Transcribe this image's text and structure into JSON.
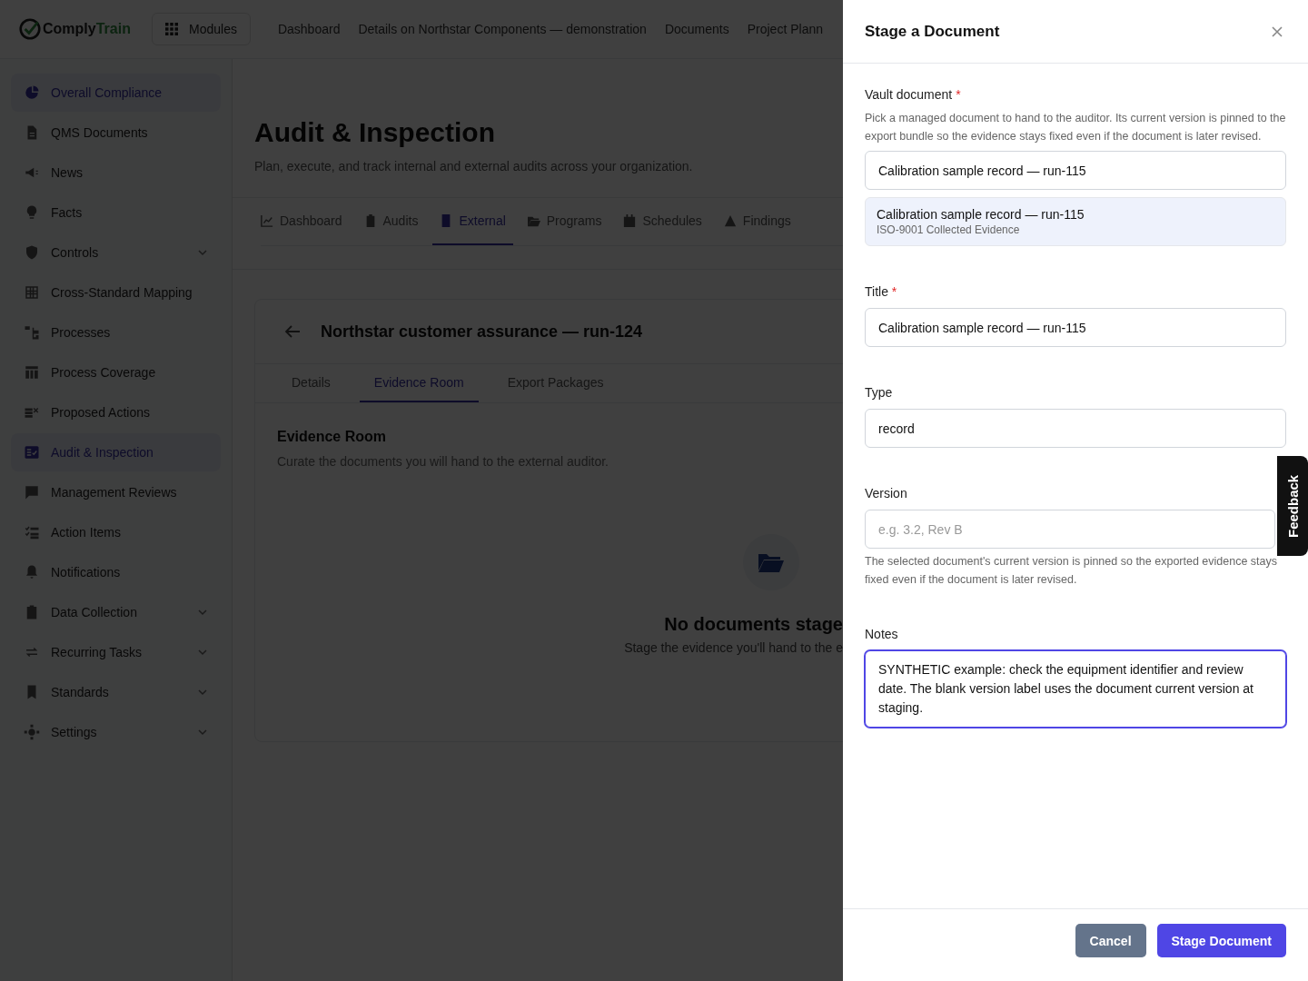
{
  "brand": {
    "prefix": "Comply",
    "suffix": "Train"
  },
  "top_nav": {
    "modules_button": "Modules",
    "links": [
      "Dashboard",
      "Details on Northstar Components — demonstration",
      "Documents",
      "Project Plann"
    ]
  },
  "sidebar": {
    "items": [
      {
        "label": "Overall Compliance",
        "selected": true,
        "expandable": false
      },
      {
        "label": "QMS Documents",
        "selected": false,
        "expandable": false
      },
      {
        "label": "News",
        "selected": false,
        "expandable": false
      },
      {
        "label": "Facts",
        "selected": false,
        "expandable": false
      },
      {
        "label": "Controls",
        "selected": false,
        "expandable": true
      },
      {
        "label": "Cross-Standard Mapping",
        "selected": false,
        "expandable": false
      },
      {
        "label": "Processes",
        "selected": false,
        "expandable": false
      },
      {
        "label": "Process Coverage",
        "selected": false,
        "expandable": false
      },
      {
        "label": "Proposed Actions",
        "selected": false,
        "expandable": false
      },
      {
        "label": "Audit & Inspection",
        "selected": true,
        "expandable": false
      },
      {
        "label": "Management Reviews",
        "selected": false,
        "expandable": false
      },
      {
        "label": "Action Items",
        "selected": false,
        "expandable": false
      },
      {
        "label": "Notifications",
        "selected": false,
        "expandable": false
      },
      {
        "label": "Data Collection",
        "selected": false,
        "expandable": true
      },
      {
        "label": "Recurring Tasks",
        "selected": false,
        "expandable": true
      },
      {
        "label": "Standards",
        "selected": false,
        "expandable": true
      },
      {
        "label": "Settings",
        "selected": false,
        "expandable": true
      }
    ]
  },
  "page": {
    "title": "Audit & Inspection",
    "subtitle": "Plan, execute, and track internal and external audits across your organization.",
    "tabs": [
      {
        "label": "Dashboard",
        "selected": false
      },
      {
        "label": "Audits",
        "selected": false
      },
      {
        "label": "External",
        "selected": true
      },
      {
        "label": "Programs",
        "selected": false
      },
      {
        "label": "Schedules",
        "selected": false
      },
      {
        "label": "Findings",
        "selected": false
      }
    ],
    "card": {
      "title": "Northstar customer assurance — run-124",
      "tabs": [
        {
          "label": "Details",
          "selected": false
        },
        {
          "label": "Evidence Room",
          "selected": true
        },
        {
          "label": "Export Packages",
          "selected": false
        }
      ],
      "section_title": "Evidence Room",
      "section_text": "Curate the documents you will hand to the external auditor.",
      "empty_title": "No documents stage",
      "empty_text": "Stage the evidence you'll hand to the e"
    }
  },
  "drawer": {
    "title": "Stage a Document",
    "vault_document": {
      "label": "Vault document",
      "required_mark": "*",
      "help": "Pick a managed document to hand to the auditor. Its current version is pinned to the export bundle so the evidence stays fixed even if the document is later revised.",
      "value": "Calibration sample record — run-115",
      "suggestion": {
        "title": "Calibration sample record — run-115",
        "subtitle": "ISO-9001 Collected Evidence",
        "highlighted": true
      }
    },
    "title_field": {
      "label": "Title",
      "required_mark": "*",
      "value": "Calibration sample record — run-115"
    },
    "type_field": {
      "label": "Type",
      "value": "record"
    },
    "version_field": {
      "label": "Version",
      "placeholder": "e.g. 3.2, Rev B",
      "help": "The selected document's current version is pinned so the exported evidence stays fixed even if the document is later revised."
    },
    "notes_field": {
      "label": "Notes",
      "value": "SYNTHETIC example: check the equipment identifier and review date. The blank version label uses the document current version at staging.",
      "focused": true
    },
    "cancel_button": "Cancel",
    "submit_button": "Stage Document"
  },
  "feedback_tab": "Feedback"
}
